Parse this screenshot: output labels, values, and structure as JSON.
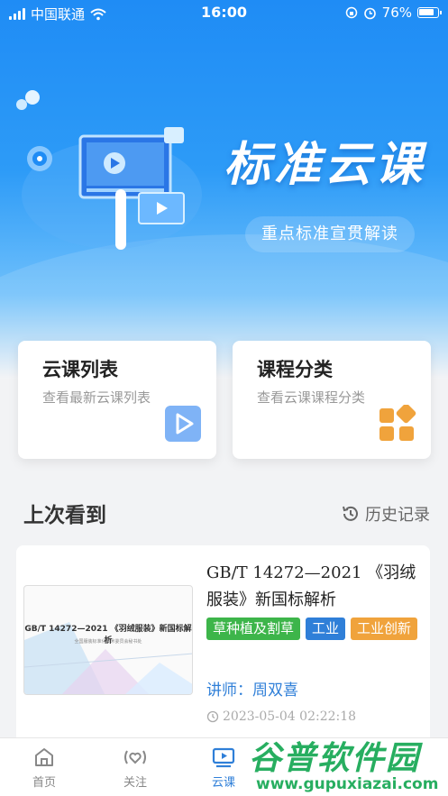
{
  "status_bar": {
    "carrier": "中国联通",
    "time": "16:00",
    "battery": "76%"
  },
  "hero": {
    "title": "标准云课",
    "subtitle": "重点标准宣贯解读"
  },
  "cards": [
    {
      "title": "云课列表",
      "subtitle": "查看最新云课列表",
      "icon": "play-icon"
    },
    {
      "title": "课程分类",
      "subtitle": "查看云课课程分类",
      "icon": "category-grid-icon"
    }
  ],
  "last_watched": {
    "section_title": "上次看到",
    "history_label": "历史记录",
    "course": {
      "title": "GB/T 14272—2021 《羽绒服装》新国标解析",
      "thumb_title": "GB/T 14272—2021 《羽绒服装》新国标解析",
      "thumb_subtitle": "全国服装标准化技术委员会秘书处",
      "tags": [
        {
          "label": "草种植及割草",
          "color": "#3db54a"
        },
        {
          "label": "工业",
          "color": "#2f7fd8"
        },
        {
          "label": "工业创新",
          "color": "#f0a33c"
        }
      ],
      "lecturer": "讲师：周双喜",
      "timestamp": "2023-05-04 02:22:18"
    }
  },
  "tabbar": {
    "tabs": [
      {
        "label": "首页",
        "icon": "home-icon"
      },
      {
        "label": "关注",
        "icon": "heart-signal-icon"
      },
      {
        "label": "云课",
        "icon": "video-icon",
        "active": true
      }
    ]
  },
  "watermark": {
    "text": "谷普软件园",
    "url": "www.gupuxiazai.com"
  },
  "colors": {
    "primary": "#1f8cf5",
    "accent_blue": "#2f7fd8",
    "green": "#3db54a",
    "orange": "#f0a33c"
  }
}
